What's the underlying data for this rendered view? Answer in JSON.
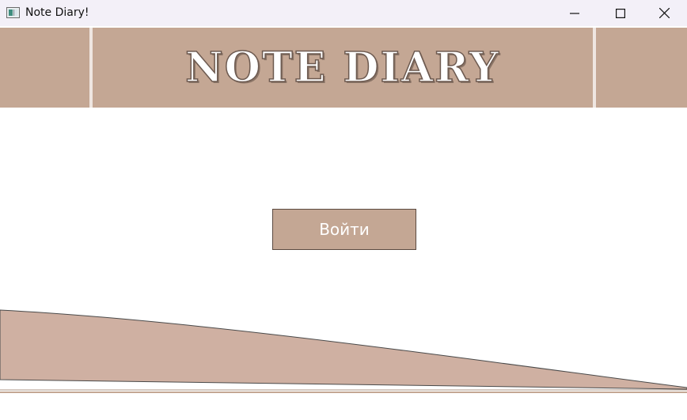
{
  "window": {
    "title": "Note Diary!",
    "controls": [
      "minimize-icon",
      "maximize-icon",
      "close-icon"
    ]
  },
  "header": {
    "title": "NOTE DIARY"
  },
  "main": {
    "login_button_label": "Войти"
  },
  "colors": {
    "accent": "#c4a794",
    "wave": "#cfb0a2",
    "titlebar": "#f3f0f8"
  }
}
